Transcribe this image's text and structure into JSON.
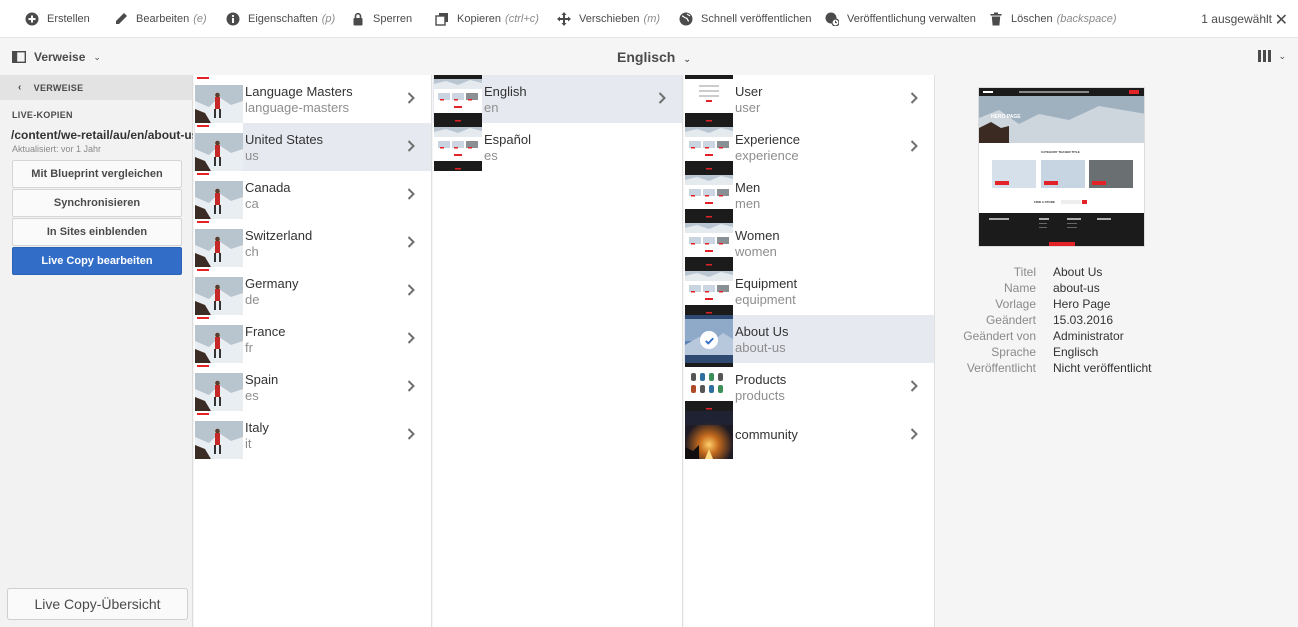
{
  "toolbar": {
    "items": [
      {
        "label": "Erstellen",
        "shortcut": "",
        "icon": "plus-circle-icon"
      },
      {
        "label": "Bearbeiten",
        "shortcut": "(e)",
        "icon": "pencil-icon"
      },
      {
        "label": "Eigenschaften",
        "shortcut": "(p)",
        "icon": "info-icon"
      },
      {
        "label": "Sperren",
        "shortcut": "",
        "icon": "lock-icon"
      },
      {
        "label": "Kopieren",
        "shortcut": "(ctrl+c)",
        "icon": "copy-icon"
      },
      {
        "label": "Verschieben",
        "shortcut": "(m)",
        "icon": "move-icon"
      },
      {
        "label": "Schnell veröffentlichen",
        "shortcut": "",
        "icon": "globe-icon"
      },
      {
        "label": "Veröffentlichung verwalten",
        "shortcut": "",
        "icon": "globe-clock-icon"
      },
      {
        "label": "Löschen",
        "shortcut": "(backspace)",
        "icon": "trash-icon"
      }
    ],
    "selection_count": "1 ausgewählt"
  },
  "subbar": {
    "rail_selector": "Verweise",
    "title": "Englisch"
  },
  "rail": {
    "back_label": "VERWEISE",
    "section_title": "LIVE-KOPIEN",
    "path": "/content/we-retail/au/en/about-us",
    "updated": "Aktualisiert: vor 1 Jahr",
    "buttons": [
      "Mit Blueprint vergleichen",
      "Synchronisieren",
      "In Sites einblenden",
      "Live Copy bearbeiten"
    ],
    "footer_button": "Live Copy-Übersicht"
  },
  "columns": [
    {
      "items": [
        {
          "title": "Language Masters",
          "name": "language-masters"
        },
        {
          "title": "United States",
          "name": "us"
        },
        {
          "title": "Canada",
          "name": "ca"
        },
        {
          "title": "Switzerland",
          "name": "ch"
        },
        {
          "title": "Germany",
          "name": "de"
        },
        {
          "title": "France",
          "name": "fr"
        },
        {
          "title": "Spain",
          "name": "es"
        },
        {
          "title": "Italy",
          "name": "it"
        }
      ]
    },
    {
      "items": [
        {
          "title": "English",
          "name": "en"
        },
        {
          "title": "Español",
          "name": "es"
        }
      ]
    },
    {
      "items": [
        {
          "title": "User",
          "name": "user"
        },
        {
          "title": "Experience",
          "name": "experience"
        },
        {
          "title": "Men",
          "name": "men"
        },
        {
          "title": "Women",
          "name": "women"
        },
        {
          "title": "Equipment",
          "name": "equipment"
        },
        {
          "title": "About Us",
          "name": "about-us"
        },
        {
          "title": "Products",
          "name": "products"
        },
        {
          "title": "community",
          "name": ""
        }
      ]
    }
  ],
  "preview": {
    "hero_text": "HERO PAGE",
    "section_title": "CATEGORY TEASER TITLE",
    "store_text": "FIND A STORE"
  },
  "details": [
    {
      "key": "Titel",
      "value": "About Us"
    },
    {
      "key": "Name",
      "value": "about-us"
    },
    {
      "key": "Vorlage",
      "value": "Hero Page"
    },
    {
      "key": "Geändert",
      "value": "15.03.2016"
    },
    {
      "key": "Geändert von",
      "value": "Administrator"
    },
    {
      "key": "Sprache",
      "value": "Englisch"
    },
    {
      "key": "Veröffentlicht",
      "value": "Nicht veröffentlicht"
    }
  ],
  "colors": {
    "primary": "#326ec8",
    "selected_row": "#e6e9ef",
    "accent_red": "#e32228"
  }
}
